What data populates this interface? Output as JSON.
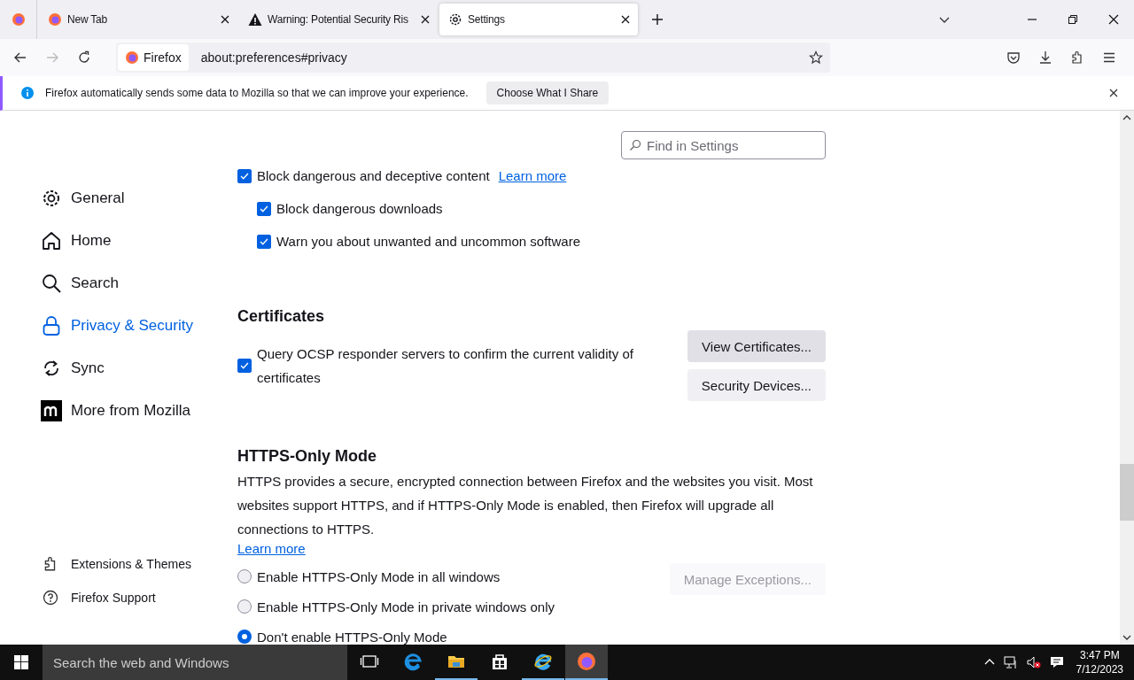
{
  "tabs": [
    {
      "kind": "pinned",
      "selected": false
    },
    {
      "kind": "tab",
      "label": "New Tab",
      "selected": false
    },
    {
      "kind": "tab",
      "label": "Warning: Potential Security Ris",
      "selected": false
    },
    {
      "kind": "tab",
      "label": "Settings",
      "selected": true
    }
  ],
  "url_bar": {
    "identity": "Firefox",
    "url": "about:preferences#privacy"
  },
  "notification": {
    "text": "Firefox automatically sends some data to Mozilla so that we can improve your experience.",
    "button": "Choose What I Share"
  },
  "search": {
    "placeholder": "Find in Settings"
  },
  "sidebar": {
    "items": [
      {
        "label": "General",
        "selected": false
      },
      {
        "label": "Home",
        "selected": false
      },
      {
        "label": "Search",
        "selected": false
      },
      {
        "label": "Privacy & Security",
        "selected": true
      },
      {
        "label": "Sync",
        "selected": false
      },
      {
        "label": "More from Mozilla",
        "selected": false
      }
    ],
    "footer": [
      {
        "label": "Extensions & Themes"
      },
      {
        "label": "Firefox Support"
      }
    ]
  },
  "protection": [
    {
      "label": "Block dangerous and deceptive content",
      "checked": true,
      "link": "Learn more",
      "children": [
        {
          "label": "Block dangerous downloads",
          "checked": true
        },
        {
          "label": "Warn you about unwanted and uncommon software",
          "checked": true
        }
      ]
    }
  ],
  "certificates": {
    "heading": "Certificates",
    "checkbox": {
      "label": "Query OCSP responder servers to confirm the current validity of certificates",
      "checked": true
    },
    "buttons": [
      {
        "label": "View Certificates...",
        "disabled": false
      },
      {
        "label": "Security Devices...",
        "disabled": false
      }
    ]
  },
  "https_only": {
    "heading": "HTTPS-Only Mode",
    "description": "HTTPS provides a secure, encrypted connection between Firefox and the websites you visit. Most websites support HTTPS, and if HTTPS-Only Mode is enabled, then Firefox will upgrade all connections to HTTPS.",
    "link": "Learn more",
    "radios": [
      {
        "label": "Enable HTTPS-Only Mode in all windows",
        "selected": false
      },
      {
        "label": "Enable HTTPS-Only Mode in private windows only",
        "selected": false
      },
      {
        "label": "Don't enable HTTPS-Only Mode",
        "selected": true
      }
    ],
    "button": {
      "label": "Manage Exceptions...",
      "disabled": true
    }
  },
  "taskbar": {
    "search_placeholder": "Search the web and Windows",
    "apps": [
      {
        "running": false,
        "active": false
      },
      {
        "running": false,
        "active": false
      },
      {
        "running": true,
        "active": false
      },
      {
        "running": false,
        "active": false
      },
      {
        "running": true,
        "active": false
      },
      {
        "running": true,
        "active": true
      }
    ],
    "time": "3:47 PM",
    "date": "7/12/2023"
  }
}
